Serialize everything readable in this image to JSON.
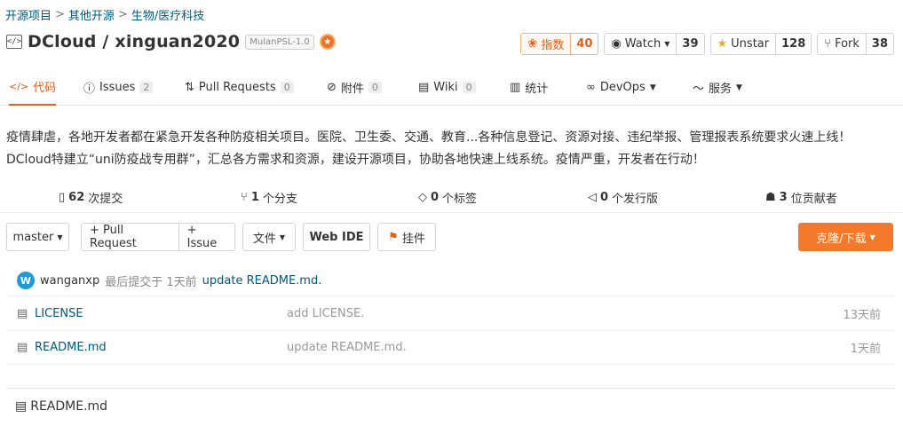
{
  "breadcrumb": [
    "开源项目",
    "其他开源",
    "生物/医疗科技"
  ],
  "repo": {
    "name": "DCloud / xinguan2020",
    "license": "MulanPSL-1.0",
    "code_badge": "</>"
  },
  "actions": {
    "index": {
      "label": "指数",
      "count": "40"
    },
    "watch": {
      "label": "Watch",
      "count": "39"
    },
    "star": {
      "label": "Unstar",
      "count": "128"
    },
    "fork": {
      "label": "Fork",
      "count": "38"
    }
  },
  "tabs": [
    {
      "label": "代码",
      "icon": "code-icon"
    },
    {
      "label": "Issues",
      "count": "2",
      "icon": "issue-icon"
    },
    {
      "label": "Pull Requests",
      "count": "0",
      "icon": "pull-request-icon"
    },
    {
      "label": "附件",
      "count": "0",
      "icon": "attachment-icon"
    },
    {
      "label": "Wiki",
      "count": "0",
      "icon": "wiki-icon"
    },
    {
      "label": "统计",
      "icon": "chart-icon"
    },
    {
      "label": "DevOps",
      "icon": "devops-icon"
    },
    {
      "label": "服务",
      "icon": "service-icon"
    }
  ],
  "description": "疫情肆虐，各地开发者都在紧急开发各种防疫相关项目。医院、卫生委、交通、教育...各种信息登记、资源对接、违纪举报、管理报表系统要求火速上线！ DCloud特建立“uni防疫战专用群”，汇总各方需求和资源，建设开源项目，协助各地快速上线系统。疫情严重，开发者在行动！",
  "stats": [
    {
      "num": "62",
      "label": "次提交",
      "icon": "commit-icon"
    },
    {
      "num": "1",
      "label": "个分支",
      "icon": "branch-icon"
    },
    {
      "num": "0",
      "label": "个标签",
      "icon": "tag-icon"
    },
    {
      "num": "0",
      "label": "个发行版",
      "icon": "release-icon"
    },
    {
      "num": "3",
      "label": "位贡献者",
      "icon": "contributor-icon"
    }
  ],
  "toolbar": {
    "branch": "master",
    "pull_request": "+ Pull Request",
    "issue": "+ Issue",
    "files": "文件",
    "web_ide": "Web IDE",
    "bookmark": "挂件",
    "clone": "克隆/下载"
  },
  "commit": {
    "avatar": "W",
    "user": "wanganxp",
    "meta": "最后提交于 1天前",
    "message": "update README.md."
  },
  "files": [
    {
      "name": "LICENSE",
      "message": "add LICENSE.",
      "time": "13天前"
    },
    {
      "name": "README.md",
      "message": "update README.md.",
      "time": "1天前"
    }
  ],
  "readme_title": "README.md",
  "colors": {
    "accent": "#e3601d",
    "link": "#005980",
    "clone_bg": "#f5792a"
  }
}
